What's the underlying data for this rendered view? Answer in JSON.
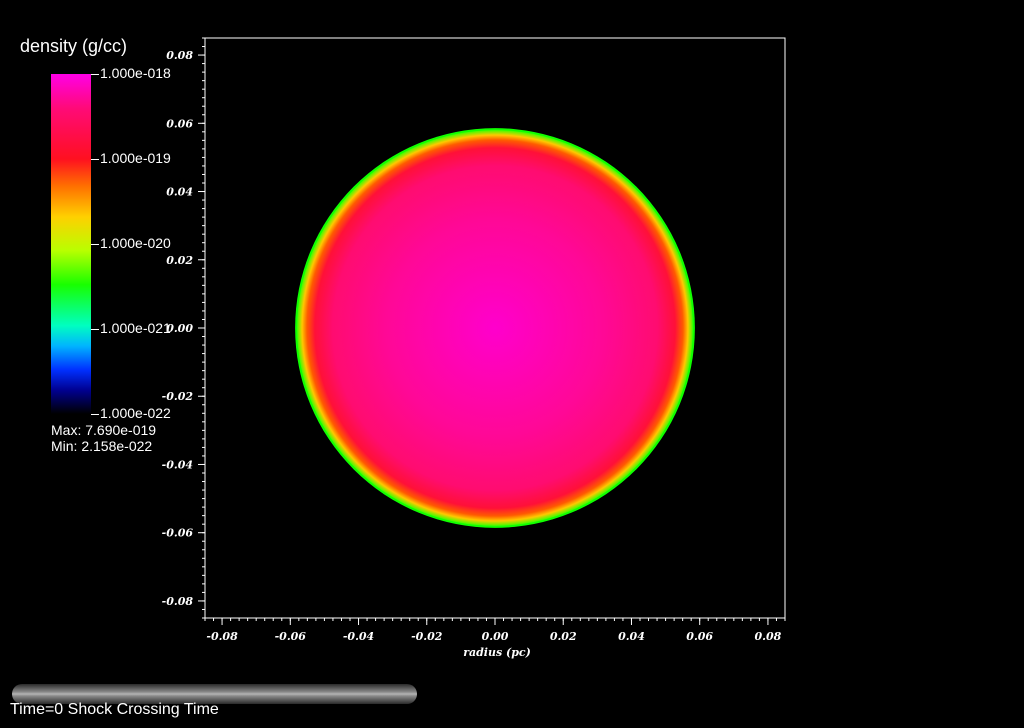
{
  "chart_data": {
    "type": "heatmap",
    "title": "",
    "xlabel": "radius (pc)",
    "ylabel": "",
    "xlim": [
      -0.085,
      0.085
    ],
    "ylim": [
      -0.085,
      0.085
    ],
    "x_ticks": [
      "-0.08",
      "-0.06",
      "-0.04",
      "-0.02",
      "0.00",
      "0.02",
      "0.04",
      "0.06",
      "0.08"
    ],
    "y_ticks": [
      "0.08",
      "0.06",
      "0.04",
      "0.02",
      "0.00",
      "-0.02",
      "-0.04",
      "-0.06",
      "-0.08"
    ],
    "field": "density (g/cc)",
    "cloud": {
      "center": [
        0.0,
        0.0
      ],
      "radius": 0.058
    },
    "background_value": "2.158e-022",
    "colorbar": {
      "title": "density (g/cc)",
      "scale": "log",
      "range": [
        1e-22,
        1e-18
      ],
      "labels": [
        "1.000e-018",
        "1.000e-019",
        "1.000e-020",
        "1.000e-021",
        "1.000e-022"
      ],
      "colors": [
        "#ff00e6",
        "#ff1020",
        "#ffd000",
        "#18ff00",
        "#00ffc0",
        "#0030ff",
        "#000000"
      ]
    },
    "max": "Max:  7.690e-019",
    "min": "Min:  2.158e-022"
  },
  "footer": {
    "caption": "Time=0 Shock Crossing Time",
    "progress": 0
  }
}
